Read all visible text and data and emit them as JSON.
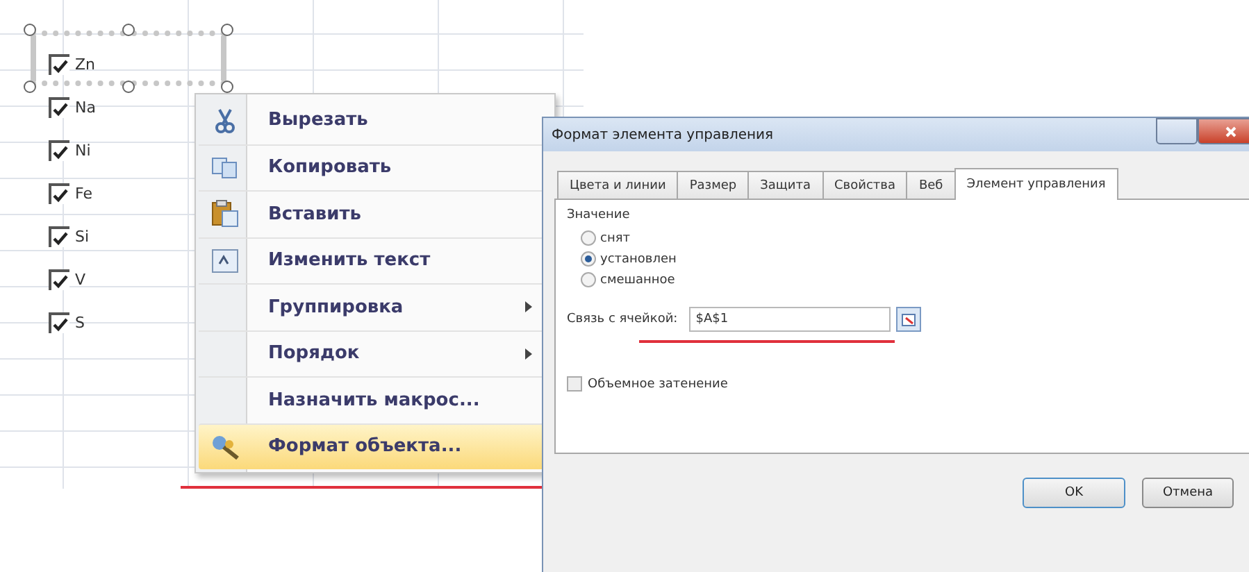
{
  "sheet": {
    "checkboxes": [
      {
        "label": "Zn",
        "checked": true,
        "selected": true
      },
      {
        "label": "Na",
        "checked": true,
        "selected": false
      },
      {
        "label": "Ni",
        "checked": true,
        "selected": false
      },
      {
        "label": "Fe",
        "checked": true,
        "selected": false
      },
      {
        "label": "Si",
        "checked": true,
        "selected": false
      },
      {
        "label": "V",
        "checked": true,
        "selected": false
      },
      {
        "label": "S",
        "checked": true,
        "selected": false
      }
    ]
  },
  "context_menu": {
    "items": [
      {
        "label": "Вырезать",
        "submenu": false,
        "selected": false
      },
      {
        "label": "Копировать",
        "submenu": false,
        "selected": false
      },
      {
        "label": "Вставить",
        "submenu": false,
        "selected": false
      },
      {
        "label": "Изменить текст",
        "submenu": false,
        "selected": false
      },
      {
        "label": "Группировка",
        "submenu": true,
        "selected": false
      },
      {
        "label": "Порядок",
        "submenu": true,
        "selected": false
      },
      {
        "label": "Назначить макрос...",
        "submenu": false,
        "selected": false
      },
      {
        "label": "Формат объекта...",
        "submenu": false,
        "selected": true
      }
    ]
  },
  "dialog": {
    "title": "Формат элемента управления",
    "tabs": [
      {
        "label": "Цвета и линии",
        "selected": false
      },
      {
        "label": "Размер",
        "selected": false
      },
      {
        "label": "Защита",
        "selected": false
      },
      {
        "label": "Свойства",
        "selected": false
      },
      {
        "label": "Веб",
        "selected": false
      },
      {
        "label": "Элемент управления",
        "selected": true
      }
    ],
    "value_group": {
      "label": "Значение",
      "options": [
        {
          "label": "снят",
          "selected": false
        },
        {
          "label": "установлен",
          "selected": true
        },
        {
          "label": "смешанное",
          "selected": false
        }
      ]
    },
    "cell_link": {
      "label": "Связь с ячейкой:",
      "value": "$A$1"
    },
    "shading": {
      "label": "Объемное затенение",
      "checked": false
    },
    "buttons": [
      "OK",
      "Отмена"
    ]
  }
}
